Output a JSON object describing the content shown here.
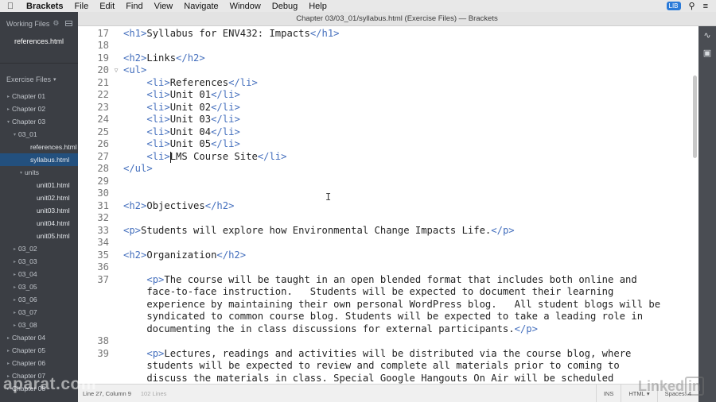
{
  "menubar": {
    "apple": "",
    "app": "Brackets",
    "items": [
      "File",
      "Edit",
      "Find",
      "View",
      "Navigate",
      "Window",
      "Debug",
      "Help"
    ],
    "right_badge": "LIB"
  },
  "window": {
    "title": "Chapter 03/03_01/syllabus.html (Exercise Files) — Brackets"
  },
  "sidebar": {
    "working_files_label": "Working Files",
    "working_files": [
      "references.html"
    ],
    "project_label": "Exercise Files",
    "tree": [
      {
        "label": "Chapter 01",
        "depth": 0,
        "kind": "folder",
        "open": false
      },
      {
        "label": "Chapter 02",
        "depth": 0,
        "kind": "folder",
        "open": false
      },
      {
        "label": "Chapter 03",
        "depth": 0,
        "kind": "folder",
        "open": true
      },
      {
        "label": "03_01",
        "depth": 1,
        "kind": "folder",
        "open": true
      },
      {
        "label": "references.html",
        "depth": 2,
        "kind": "file"
      },
      {
        "label": "syllabus.html",
        "depth": 2,
        "kind": "file",
        "selected": true
      },
      {
        "label": "units",
        "depth": 2,
        "kind": "folder",
        "open": true
      },
      {
        "label": "unit01.html",
        "depth": 3,
        "kind": "file"
      },
      {
        "label": "unit02.html",
        "depth": 3,
        "kind": "file"
      },
      {
        "label": "unit03.html",
        "depth": 3,
        "kind": "file"
      },
      {
        "label": "unit04.html",
        "depth": 3,
        "kind": "file"
      },
      {
        "label": "unit05.html",
        "depth": 3,
        "kind": "file"
      },
      {
        "label": "03_02",
        "depth": 1,
        "kind": "folder",
        "open": false
      },
      {
        "label": "03_03",
        "depth": 1,
        "kind": "folder",
        "open": false
      },
      {
        "label": "03_04",
        "depth": 1,
        "kind": "folder",
        "open": false
      },
      {
        "label": "03_05",
        "depth": 1,
        "kind": "folder",
        "open": false
      },
      {
        "label": "03_06",
        "depth": 1,
        "kind": "folder",
        "open": false
      },
      {
        "label": "03_07",
        "depth": 1,
        "kind": "folder",
        "open": false
      },
      {
        "label": "03_08",
        "depth": 1,
        "kind": "folder",
        "open": false
      },
      {
        "label": "Chapter 04",
        "depth": 0,
        "kind": "folder",
        "open": false
      },
      {
        "label": "Chapter 05",
        "depth": 0,
        "kind": "folder",
        "open": false
      },
      {
        "label": "Chapter 06",
        "depth": 0,
        "kind": "folder",
        "open": false
      },
      {
        "label": "Chapter 07",
        "depth": 0,
        "kind": "folder",
        "open": false
      },
      {
        "label": "Chapter 08",
        "depth": 0,
        "kind": "folder",
        "open": false
      }
    ]
  },
  "editor": {
    "lines": [
      {
        "n": "17",
        "text": "<h1>Syllabus for ENV432: Impacts</h1>"
      },
      {
        "n": "18",
        "text": ""
      },
      {
        "n": "19",
        "text": "<h2>Links</h2>"
      },
      {
        "n": "20",
        "text": "<ul>",
        "fold": true
      },
      {
        "n": "21",
        "text": "    <li>References</li>"
      },
      {
        "n": "22",
        "text": "    <li>Unit 01</li>"
      },
      {
        "n": "23",
        "text": "    <li>Unit 02</li>"
      },
      {
        "n": "24",
        "text": "    <li>Unit 03</li>"
      },
      {
        "n": "25",
        "text": "    <li>Unit 04</li>"
      },
      {
        "n": "26",
        "text": "    <li>Unit 05</li>"
      },
      {
        "n": "27",
        "text": "    <li>LMS Course Site</li>"
      },
      {
        "n": "28",
        "text": "</ul>"
      },
      {
        "n": "29",
        "text": ""
      },
      {
        "n": "30",
        "text": ""
      },
      {
        "n": "31",
        "text": "<h2>Objectives</h2>"
      },
      {
        "n": "32",
        "text": ""
      },
      {
        "n": "33",
        "text": "<p>Students will explore how Environmental Change Impacts Life.</p>"
      },
      {
        "n": "34",
        "text": ""
      },
      {
        "n": "35",
        "text": "<h2>Organization</h2>"
      },
      {
        "n": "36",
        "text": ""
      },
      {
        "n": "37",
        "text": "    <p>The course will be taught in an open blended format that includes both online and"
      },
      {
        "n": "",
        "text": "    face-to-face instruction.   Students will be expected to document their learning"
      },
      {
        "n": "",
        "text": "    experience by maintaining their own personal WordPress blog.   All student blogs will be"
      },
      {
        "n": "",
        "text": "    syndicated to common course blog. Students will be expected to take a leading role in"
      },
      {
        "n": "",
        "text": "    documenting the in class discussions for external participants.</p>"
      },
      {
        "n": "38",
        "text": ""
      },
      {
        "n": "39",
        "text": "    <p>Lectures, readings and activities will be distributed via the course blog, where"
      },
      {
        "n": "",
        "text": "    students will be expected to review and complete all materials prior to coming to"
      },
      {
        "n": "",
        "text": "    discuss the materials in class. Special Google Hangouts On Air will be scheduled"
      }
    ]
  },
  "statusbar": {
    "cursor_position": "Line 27, Column 9",
    "line_count": "102 Lines",
    "ins": "INS",
    "language": "HTML",
    "spaces": "Spaces: 4"
  },
  "watermarks": {
    "left": "aparat.com",
    "right": "Linked",
    "right_in": "in"
  }
}
